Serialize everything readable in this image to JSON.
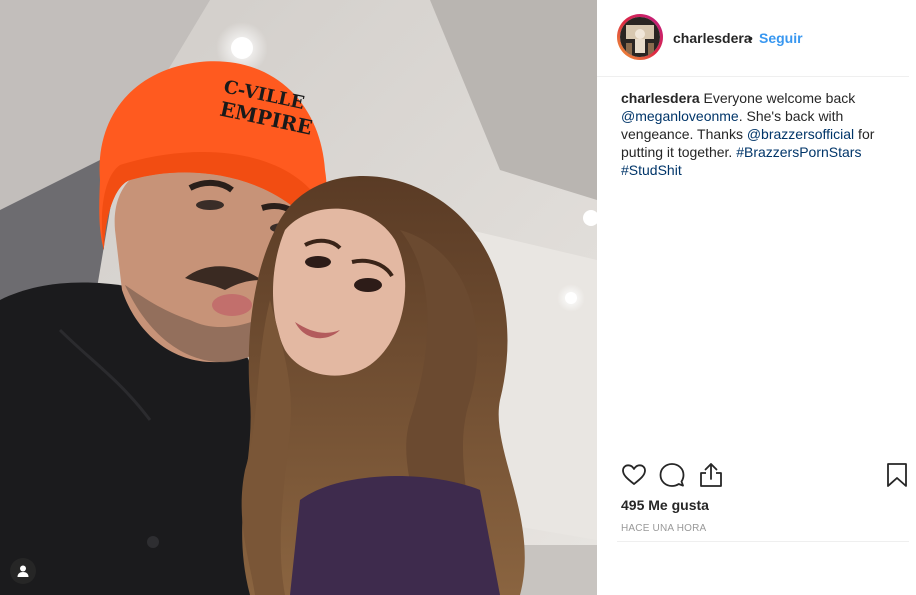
{
  "post": {
    "username": "charlesdera",
    "separator": "•",
    "follow_label": "Seguir",
    "hat_text_line1": "C-VILLE",
    "hat_text_line2": "EMPIRE"
  },
  "caption": {
    "username": "charlesdera",
    "text_1": "Everyone welcome back ",
    "mention_1": "@meganloveonme",
    "text_2": ". She's back with vengeance. Thanks ",
    "mention_2": "@brazzersofficial",
    "text_3": " for putting it together. ",
    "hashtag_1": "#BrazzersPornStars",
    "text_4": " ",
    "hashtag_2": "#StudShit"
  },
  "stats": {
    "likes": "495 Me gusta",
    "time": "HACE UNA HORA"
  },
  "icons": {
    "like": "heart-icon",
    "comment": "comment-icon",
    "share": "share-icon",
    "save": "bookmark-icon",
    "tag": "user-tag-icon"
  },
  "colors": {
    "follow": "#3897f0",
    "link": "#003569",
    "text": "#262626",
    "muted": "#999999",
    "beanie": "#ff5a1f"
  }
}
